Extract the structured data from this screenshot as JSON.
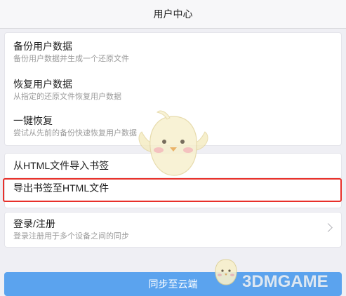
{
  "header": {
    "title": "用户中心"
  },
  "data_section": {
    "items": [
      {
        "title": "备份用户数据",
        "desc": "备份用户数据并生成一个还原文件"
      },
      {
        "title": "恢复用户数据",
        "desc": "从指定的还原文件恢复用户数据"
      },
      {
        "title": "一键恢复",
        "desc": "尝试从先前的备份快速恢复用户数据"
      }
    ]
  },
  "bookmark_section": {
    "import_label": "从HTML文件导入书签",
    "export_label": "导出书签至HTML文件"
  },
  "account_section": {
    "title": "登录/注册",
    "desc": "登录注册用于多个设备之间的同步"
  },
  "sync_button": {
    "label": "同步至云端"
  },
  "watermark": {
    "text": "3DMGAME"
  },
  "colors": {
    "background": "#efeff4",
    "highlight": "#e8302a",
    "sync_button": "#5ba3ee"
  }
}
